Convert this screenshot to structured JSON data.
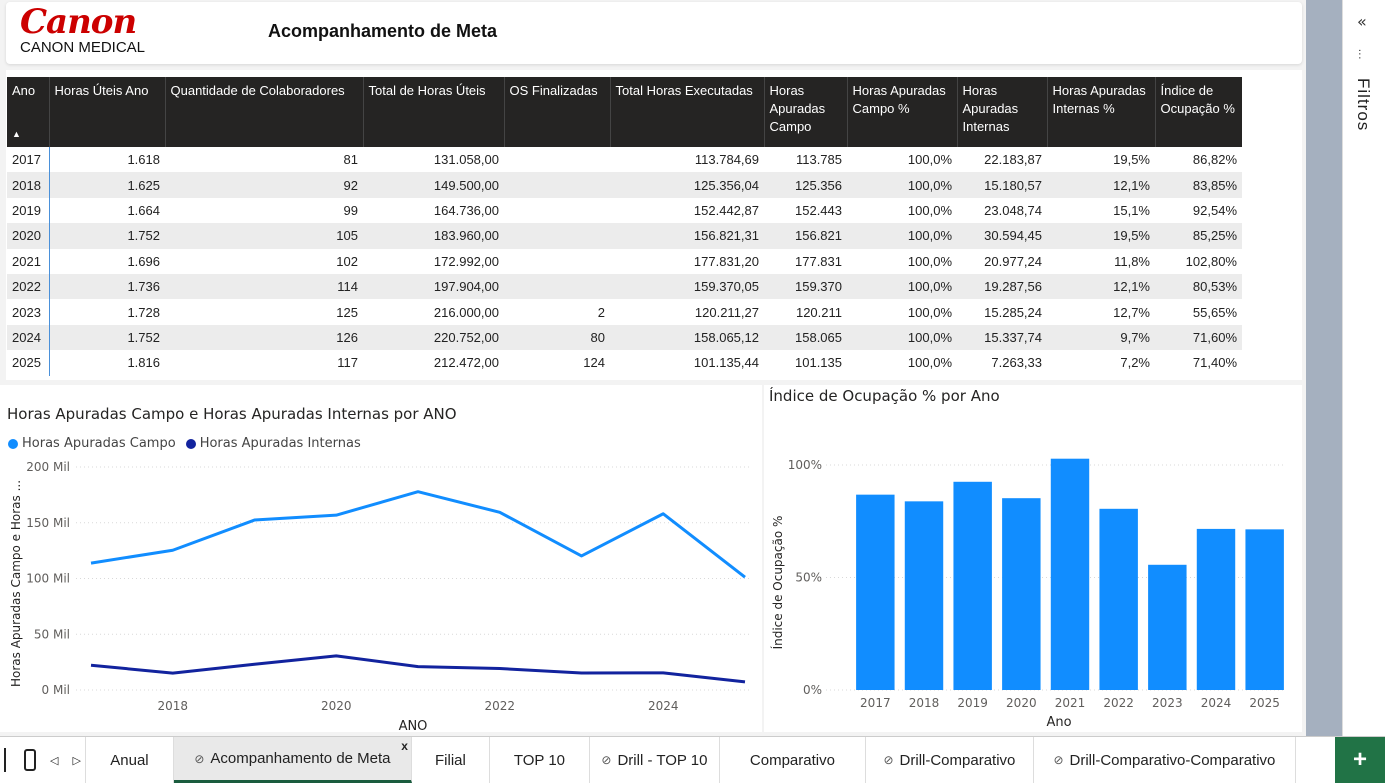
{
  "header": {
    "logo_word": "Canon",
    "logo_sub": "CANON MEDICAL",
    "title": "Acompanhamento de Meta"
  },
  "table": {
    "columns": [
      "Ano",
      "Horas Úteis Ano",
      "Quantidade de Colaboradores",
      "Total de Horas Úteis",
      "OS Finalizadas",
      "Total Horas Executadas",
      "Horas Apuradas Campo",
      "Horas Apuradas Campo %",
      "Horas Apuradas Internas",
      "Horas Apuradas Internas %",
      "Índice de Ocupação %"
    ],
    "rows": [
      [
        "2017",
        "1.618",
        "81",
        "131.058,00",
        "",
        "113.784,69",
        "113.785",
        "100,0%",
        "22.183,87",
        "19,5%",
        "86,82%"
      ],
      [
        "2018",
        "1.625",
        "92",
        "149.500,00",
        "",
        "125.356,04",
        "125.356",
        "100,0%",
        "15.180,57",
        "12,1%",
        "83,85%"
      ],
      [
        "2019",
        "1.664",
        "99",
        "164.736,00",
        "",
        "152.442,87",
        "152.443",
        "100,0%",
        "23.048,74",
        "15,1%",
        "92,54%"
      ],
      [
        "2020",
        "1.752",
        "105",
        "183.960,00",
        "",
        "156.821,31",
        "156.821",
        "100,0%",
        "30.594,45",
        "19,5%",
        "85,25%"
      ],
      [
        "2021",
        "1.696",
        "102",
        "172.992,00",
        "",
        "177.831,20",
        "177.831",
        "100,0%",
        "20.977,24",
        "11,8%",
        "102,80%"
      ],
      [
        "2022",
        "1.736",
        "114",
        "197.904,00",
        "",
        "159.370,05",
        "159.370",
        "100,0%",
        "19.287,56",
        "12,1%",
        "80,53%"
      ],
      [
        "2023",
        "1.728",
        "125",
        "216.000,00",
        "2",
        "120.211,27",
        "120.211",
        "100,0%",
        "15.285,24",
        "12,7%",
        "55,65%"
      ],
      [
        "2024",
        "1.752",
        "126",
        "220.752,00",
        "80",
        "158.065,12",
        "158.065",
        "100,0%",
        "15.337,74",
        "9,7%",
        "71,60%"
      ],
      [
        "2025",
        "1.816",
        "117",
        "212.472,00",
        "124",
        "101.135,44",
        "101.135",
        "100,0%",
        "7.263,33",
        "7,2%",
        "71,40%"
      ]
    ]
  },
  "chart_data": [
    {
      "type": "line",
      "title": "Horas Apuradas Campo e Horas Apuradas Internas por ANO",
      "xlabel": "ANO",
      "ylabel": "Horas Apuradas Campo e Horas ...",
      "x": [
        2017,
        2018,
        2019,
        2020,
        2021,
        2022,
        2023,
        2024,
        2025
      ],
      "x_ticks": [
        "2018",
        "2020",
        "2022",
        "2024"
      ],
      "y_ticks": [
        "0 Mil",
        "50 Mil",
        "100 Mil",
        "150 Mil",
        "200 Mil"
      ],
      "ylim": [
        0,
        200000
      ],
      "legend_position": "top-left",
      "series": [
        {
          "name": "Horas Apuradas Campo",
          "color": "#118dff",
          "values": [
            113785,
            125356,
            152443,
            156821,
            177831,
            159370,
            120211,
            158065,
            101135
          ]
        },
        {
          "name": "Horas Apuradas Internas",
          "color": "#12239e",
          "values": [
            22184,
            15181,
            23049,
            30594,
            20977,
            19288,
            15285,
            15338,
            7263
          ]
        }
      ]
    },
    {
      "type": "bar",
      "title": "Índice de Ocupação % por Ano",
      "xlabel": "Ano",
      "ylabel": "Índice de Ocupação %",
      "categories": [
        "2017",
        "2018",
        "2019",
        "2020",
        "2021",
        "2022",
        "2023",
        "2024",
        "2025"
      ],
      "values": [
        86.82,
        83.85,
        92.54,
        85.25,
        102.8,
        80.53,
        55.65,
        71.6,
        71.4
      ],
      "y_ticks": [
        "0%",
        "50%",
        "100%"
      ],
      "ylim": [
        0,
        100
      ],
      "color": "#118dff"
    }
  ],
  "filters": {
    "label": "Filtros",
    "collapse": "«"
  },
  "tabs": [
    {
      "label": "Anual",
      "active": false,
      "hidden": false
    },
    {
      "label": "Acompanhamento de Meta",
      "active": true,
      "hidden": true,
      "close": "x"
    },
    {
      "label": "Filial",
      "active": false,
      "hidden": false
    },
    {
      "label": "TOP 10",
      "active": false,
      "hidden": false
    },
    {
      "label": "Drill - TOP 10",
      "active": false,
      "hidden": true
    },
    {
      "label": "Comparativo",
      "active": false,
      "hidden": false
    },
    {
      "label": "Drill-Comparativo",
      "active": false,
      "hidden": true
    },
    {
      "label": "Drill-Comparativo-Comparativo",
      "active": false,
      "hidden": true
    }
  ],
  "add_page": "+"
}
